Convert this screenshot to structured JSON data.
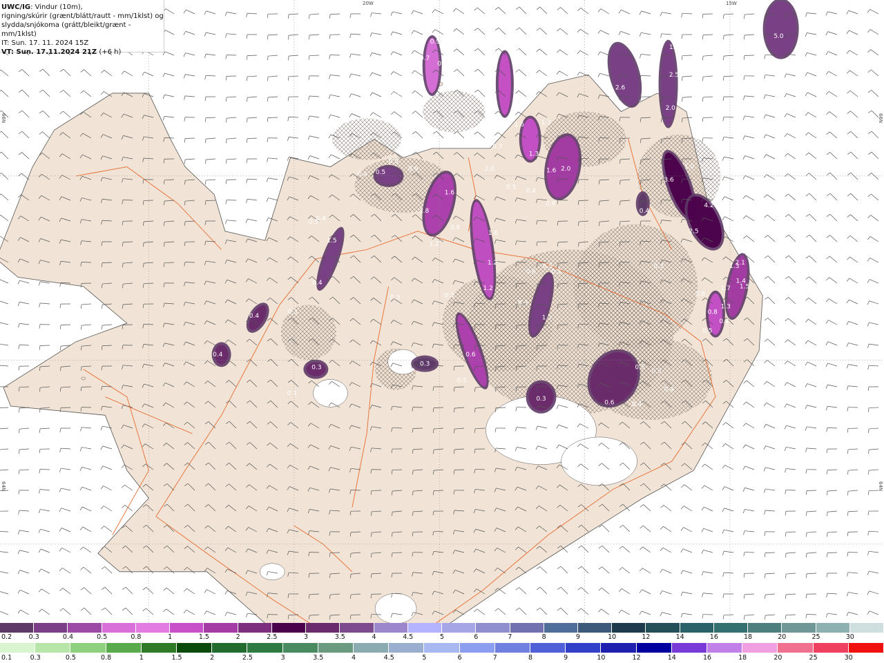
{
  "header": {
    "model": "UWC/IG",
    "line1_rest": ": Vindur (10m),",
    "line2": "rigning/skúrir (grænt/blátt/rautt - mm/1klst) og",
    "line3": "slydda/snjókoma (grátt/bleikt/grænt - mm/1klst)",
    "it": "IT: Sun. 17. 11. 2024 15Z",
    "vt": "VT: Sun. 17.11.2024 21Z",
    "vt_offset": "(+6 h)"
  },
  "coords": {
    "top_20w": "20W",
    "top_15w": "15W",
    "left_66n": "66N",
    "right_66n": "66N",
    "left_64n": "64N",
    "right_64n": "64N"
  },
  "colors": {
    "land": "#f1e4d6",
    "roads": "#e8682e",
    "coast": "#555555",
    "ice": "#ffffff"
  },
  "snow_labels": [
    {
      "text": "0.9",
      "lon": -18.06,
      "lat": 66.72
    },
    {
      "text": "0.7",
      "lon": -18.2,
      "lat": 66.63
    },
    {
      "text": "0.9",
      "lon": -17.96,
      "lat": 66.6
    },
    {
      "text": "0.7",
      "lon": -18.61,
      "lat": 66.43
    },
    {
      "text": "1.8",
      "lon": -16.97,
      "lat": 66.67
    },
    {
      "text": "1.4",
      "lon": -17.34,
      "lat": 66.53
    },
    {
      "text": "1.3",
      "lon": -16.53,
      "lat": 66.28
    },
    {
      "text": "1.6",
      "lon": -16.9,
      "lat": 66.27
    },
    {
      "text": "0.7",
      "lon": -17.2,
      "lat": 66.15
    },
    {
      "text": "1.3",
      "lon": -16.7,
      "lat": 66.11
    },
    {
      "text": "2.0",
      "lon": -17.31,
      "lat": 66.03
    },
    {
      "text": "1.6",
      "lon": -16.46,
      "lat": 66.02
    },
    {
      "text": "2.0",
      "lon": -16.26,
      "lat": 66.03
    },
    {
      "text": "0.5",
      "lon": -17.01,
      "lat": 65.93
    },
    {
      "text": "0.4",
      "lon": -16.74,
      "lat": 65.91
    },
    {
      "text": "0.9",
      "lon": -16.47,
      "lat": 65.84
    },
    {
      "text": "0.5",
      "lon": -18.63,
      "lat": 66.07
    },
    {
      "text": "0.4",
      "lon": -19.06,
      "lat": 66.0
    },
    {
      "text": "0.5",
      "lon": -18.81,
      "lat": 66.01
    },
    {
      "text": "0.6",
      "lon": -18.36,
      "lat": 66.03
    },
    {
      "text": "1.6",
      "lon": -17.86,
      "lat": 65.9
    },
    {
      "text": "1.8",
      "lon": -18.21,
      "lat": 65.8
    },
    {
      "text": "0.6",
      "lon": -17.78,
      "lat": 65.71
    },
    {
      "text": "1.2",
      "lon": -18.07,
      "lat": 65.62
    },
    {
      "text": "1.6",
      "lon": -17.26,
      "lat": 65.68
    },
    {
      "text": "1.2",
      "lon": -17.27,
      "lat": 65.52
    },
    {
      "text": "1.2",
      "lon": -17.33,
      "lat": 65.38
    },
    {
      "text": "0.5",
      "lon": -16.51,
      "lat": 65.5
    },
    {
      "text": "0.6",
      "lon": -16.74,
      "lat": 65.47
    },
    {
      "text": "0.5",
      "lon": -16.39,
      "lat": 65.47
    },
    {
      "text": "0.3",
      "lon": -16.85,
      "lat": 65.3
    },
    {
      "text": "1.3",
      "lon": -16.52,
      "lat": 65.22
    },
    {
      "text": "0.3",
      "lon": -17.86,
      "lat": 65.34
    },
    {
      "text": "0.6",
      "lon": -17.57,
      "lat": 65.02
    },
    {
      "text": "0.5",
      "lon": -17.69,
      "lat": 64.88
    },
    {
      "text": "0.4",
      "lon": -19.63,
      "lat": 65.76
    },
    {
      "text": "0.5",
      "lon": -19.73,
      "lat": 65.74
    },
    {
      "text": "1.5",
      "lon": -19.48,
      "lat": 65.64
    },
    {
      "text": "0.4",
      "lon": -19.68,
      "lat": 65.41
    },
    {
      "text": "0.3",
      "lon": -20.02,
      "lat": 65.25
    },
    {
      "text": "0.4",
      "lon": -20.55,
      "lat": 65.23
    },
    {
      "text": "0.4",
      "lon": -21.05,
      "lat": 65.02
    },
    {
      "text": "0.3",
      "lon": -19.69,
      "lat": 64.95
    },
    {
      "text": "0.3",
      "lon": -20.03,
      "lat": 64.81
    },
    {
      "text": "0.3",
      "lon": -18.2,
      "lat": 64.97
    },
    {
      "text": "0.3",
      "lon": -18.61,
      "lat": 65.33
    },
    {
      "text": "0.3",
      "lon": -16.6,
      "lat": 64.78
    },
    {
      "text": "5.0",
      "lon": -13.33,
      "lat": 66.75
    },
    {
      "text": "0.5",
      "lon": -15.9,
      "lat": 66.89
    },
    {
      "text": "1.3",
      "lon": -14.77,
      "lat": 66.69
    },
    {
      "text": "2.5",
      "lon": -14.77,
      "lat": 66.54
    },
    {
      "text": "2.6",
      "lon": -15.51,
      "lat": 66.47
    },
    {
      "text": "2.0",
      "lon": -14.82,
      "lat": 66.36
    },
    {
      "text": "3.6",
      "lon": -14.84,
      "lat": 65.97
    },
    {
      "text": "1.0",
      "lon": -14.56,
      "lat": 66.04
    },
    {
      "text": "4.2",
      "lon": -14.29,
      "lat": 65.83
    },
    {
      "text": "2.5",
      "lon": -14.5,
      "lat": 65.69
    },
    {
      "text": "0.4",
      "lon": -15.18,
      "lat": 65.8
    },
    {
      "text": "0.3",
      "lon": -14.98,
      "lat": 65.5
    },
    {
      "text": "1.3",
      "lon": -13.94,
      "lat": 65.5
    },
    {
      "text": "1.7",
      "lon": -14.06,
      "lat": 65.38
    },
    {
      "text": "2.1",
      "lon": -13.86,
      "lat": 65.52
    },
    {
      "text": "1.4",
      "lon": -13.85,
      "lat": 65.42
    },
    {
      "text": "1.5",
      "lon": -13.8,
      "lat": 65.39
    },
    {
      "text": "0.8",
      "lon": -14.41,
      "lat": 65.35
    },
    {
      "text": "1.3",
      "lon": -14.06,
      "lat": 65.28
    },
    {
      "text": "0.8",
      "lon": -14.24,
      "lat": 65.25
    },
    {
      "text": "0.4",
      "lon": -14.08,
      "lat": 65.2
    },
    {
      "text": "0.5",
      "lon": -14.31,
      "lat": 65.15
    },
    {
      "text": "0.5",
      "lon": -15.24,
      "lat": 64.95
    },
    {
      "text": "0.3",
      "lon": -15.01,
      "lat": 64.93
    },
    {
      "text": "0.4",
      "lon": -14.84,
      "lat": 64.83
    },
    {
      "text": "0.6",
      "lon": -15.66,
      "lat": 64.76
    },
    {
      "text": "0.4",
      "lon": -15.28,
      "lat": 64.75
    }
  ],
  "legend": {
    "row1_labels": [
      "0.2",
      "0.3",
      "0.4",
      "0.5",
      "0.8",
      "1",
      "1.5",
      "2",
      "2.5",
      "3",
      "3.5",
      "4",
      "4.5",
      "5",
      "6",
      "7",
      "8",
      "9",
      "10",
      "12",
      "14",
      "16",
      "18",
      "20",
      "25",
      "30"
    ],
    "row1_colors": [
      "#5e3a67",
      "#7a3f86",
      "#9d4aa6",
      "#d970d9",
      "#e27be2",
      "#c850c8",
      "#a53ba5",
      "#7e2e7e",
      "#4b004b",
      "#6b2a6b",
      "#7b4b8e",
      "#9c86cc",
      "#b3b3ff",
      "#a6a6e6",
      "#8f8fd0",
      "#7171b0",
      "#4f6f9a",
      "#3d5a7a",
      "#1f3b4b",
      "#24505a",
      "#2b6168",
      "#357070",
      "#4d7f7f",
      "#6f9797",
      "#8fb0b0",
      "#cfdede"
    ],
    "row2_labels": [
      "0.1",
      "0.3",
      "0.5",
      "0.8",
      "1",
      "1.5",
      "2",
      "2.5",
      "3",
      "3.5",
      "4",
      "4.5",
      "5",
      "6",
      "7",
      "8",
      "9",
      "10",
      "12",
      "14",
      "16",
      "18",
      "20",
      "25",
      "30"
    ],
    "row2_colors": [
      "#d9f5d0",
      "#b7e6a8",
      "#8fd07f",
      "#59a94d",
      "#2e7a27",
      "#0a4a0a",
      "#206b2d",
      "#2f7a43",
      "#4a8a60",
      "#6a9b80",
      "#8aabb0",
      "#9aaed0",
      "#a8b8f0",
      "#8c9ef0",
      "#6f80e0",
      "#5060d8",
      "#3040c8",
      "#2020b0",
      "#0000a0",
      "#7a3ad8",
      "#c080e8",
      "#f0a0e0",
      "#f07090",
      "#f04060",
      "#f01010"
    ]
  }
}
